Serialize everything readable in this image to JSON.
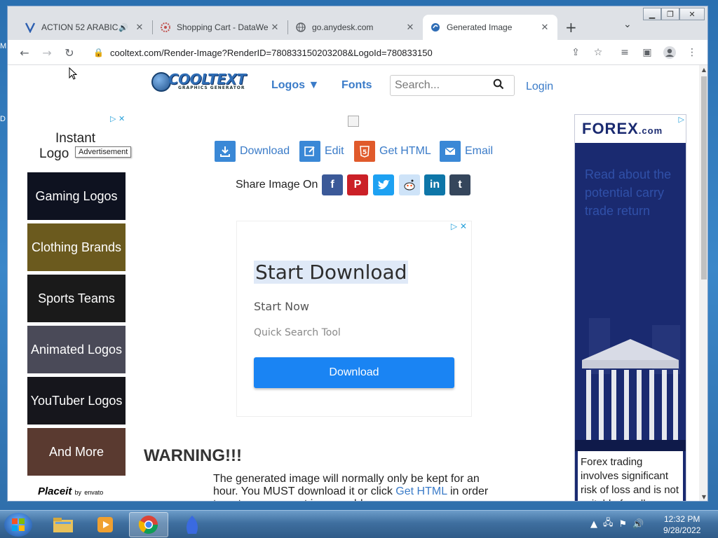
{
  "browser": {
    "tabs": [
      {
        "title": "ACTION 52 ARABIC",
        "icon": "v-logo-icon",
        "audio": true,
        "active": false
      },
      {
        "title": "Shopping Cart - DataWe",
        "icon": "gear-icon",
        "active": false
      },
      {
        "title": "go.anydesk.com",
        "icon": "globe-icon",
        "active": false
      },
      {
        "title": "Generated Image",
        "icon": "cooltext-icon",
        "active": true
      }
    ],
    "url": "cooltext.com/Render-Image?RenderID=780833150203208&LogoId=780833150"
  },
  "site": {
    "nav": {
      "logos": "Logos ▼",
      "fonts": "Fonts",
      "login": "Login"
    },
    "search_placeholder": "Search...",
    "logo_text": "COOLTEXT",
    "logo_sub": "GRAPHICS GENERATOR"
  },
  "left_ad": {
    "text_line1": "Instant",
    "text_line2": "Logo",
    "tooltip": "Advertisement"
  },
  "categories": [
    {
      "label": "Gaming Logos",
      "color": "#0e1220"
    },
    {
      "label": "Clothing Brands",
      "color": "#6b5a1e"
    },
    {
      "label": "Sports Teams",
      "color": "#1a1a1a"
    },
    {
      "label": "Animated Logos",
      "color": "#4a4a58"
    },
    {
      "label": "YouTuber Logos",
      "color": "#16161c"
    },
    {
      "label": "And More",
      "color": "#5a3a30"
    }
  ],
  "placeit": {
    "brand": "Placeit",
    "by": "by",
    "envato": "envato"
  },
  "actions": {
    "download": "Download",
    "edit": "Edit",
    "get_html": "Get HTML",
    "email": "Email"
  },
  "share": {
    "label": "Share Image On"
  },
  "center_ad": {
    "headline": "Start Download",
    "line2": "Start Now",
    "line3": "Quick Search Tool",
    "button": "Download"
  },
  "warning": {
    "title": "WARNING!!!",
    "body_prefix": "The generated image will normally only be kept for an hour. You MUST download it or click ",
    "link": "Get HTML",
    "body_suffix": " in order to get a permanent image address."
  },
  "right_ad": {
    "brand": "FOREX",
    "brand_suffix": ".com",
    "message": "Read about the potential carry trade return",
    "disclaimer": "Forex trading involves significant risk of loss and is not suitable for all"
  },
  "taskbar": {
    "time": "12:32 PM",
    "date": "9/28/2022"
  }
}
